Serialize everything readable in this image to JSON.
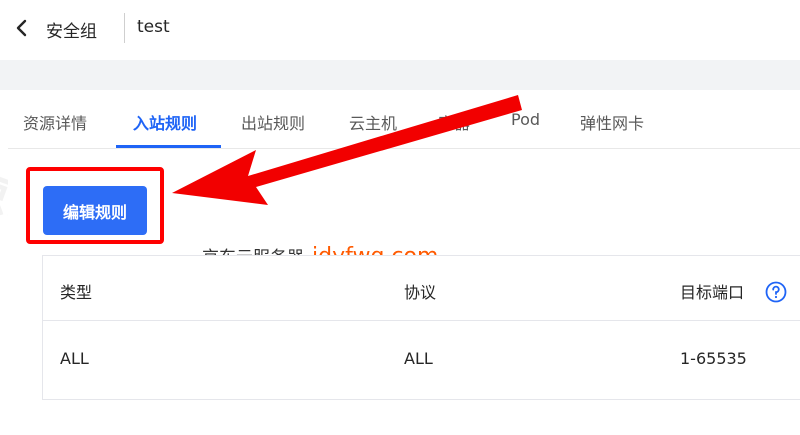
{
  "header": {
    "title": "安全组",
    "name": "test"
  },
  "tabs": [
    {
      "label": "资源详情",
      "active": false
    },
    {
      "label": "入站规则",
      "active": true
    },
    {
      "label": "出站规则",
      "active": false
    },
    {
      "label": "云主机",
      "active": false
    },
    {
      "label": "容器",
      "active": false
    },
    {
      "label": "Pod",
      "active": false
    },
    {
      "label": "弹性网卡",
      "active": false
    }
  ],
  "edit_button": {
    "label": "编辑规则"
  },
  "table": {
    "columns": [
      "类型",
      "协议",
      "目标端口"
    ],
    "rows": [
      {
        "type": "ALL",
        "protocol": "ALL",
        "port": "1-65535"
      }
    ]
  },
  "watermark": {
    "text": "京东云服务器",
    "domain": "jdyfwq.com",
    "faint": "京东云服务器 jdyfwq.com"
  },
  "colors": {
    "accent": "#1f64f6",
    "button": "#2d6df6",
    "highlight": "#ff0000",
    "watermark_domain": "#ff5a00"
  }
}
